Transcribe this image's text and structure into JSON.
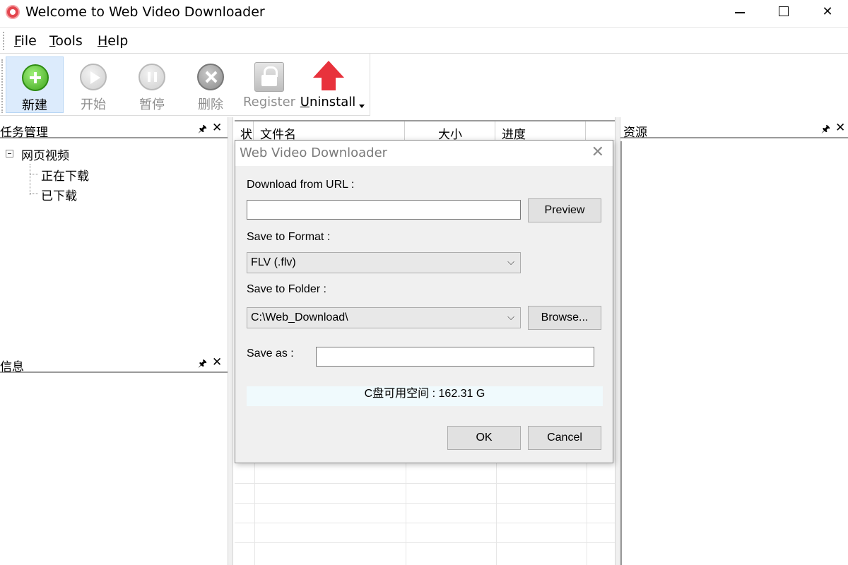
{
  "window": {
    "title": "Welcome to Web Video Downloader",
    "min": "",
    "max": "",
    "close": "✕"
  },
  "menu": [
    "File",
    "Tools",
    "Help"
  ],
  "toolbar": {
    "new": "新建",
    "start": "开始",
    "pause": "暂停",
    "delete": "删除",
    "register": "Register",
    "uninstall": "Uninstall"
  },
  "panels": {
    "task_title": "任务管理",
    "info_title": "信息",
    "resource_title": "资源",
    "pin": "ꟼ",
    "close": "✕"
  },
  "tree": {
    "root": "网页视频",
    "children": [
      "正在下载",
      "已下载"
    ]
  },
  "list": {
    "columns": [
      "状",
      "文件名",
      "大小",
      "进度"
    ]
  },
  "dialog": {
    "title": "Web Video Downloader",
    "close": "✕",
    "url_label": "Download from URL :",
    "url_value": "",
    "preview_button": "Preview",
    "format_label": "Save to Format :",
    "format_value": "FLV (.flv)",
    "folder_label": "Save to Folder :",
    "folder_value": "C:\\Web_Download\\",
    "browse_button": "Browse...",
    "saveas_label": "Save as :",
    "saveas_value": "",
    "free_space": "C盘可用空间 : 162.31 G",
    "ok_button": "OK",
    "cancel_button": "Cancel"
  },
  "colors": {
    "accent_active": "#dcebfc",
    "new_icon_green": "#3fa51d",
    "uninstall_red": "#e8323c",
    "dialog_bg": "#f0f0f0",
    "space_bar_bg": "#f0fafd"
  }
}
